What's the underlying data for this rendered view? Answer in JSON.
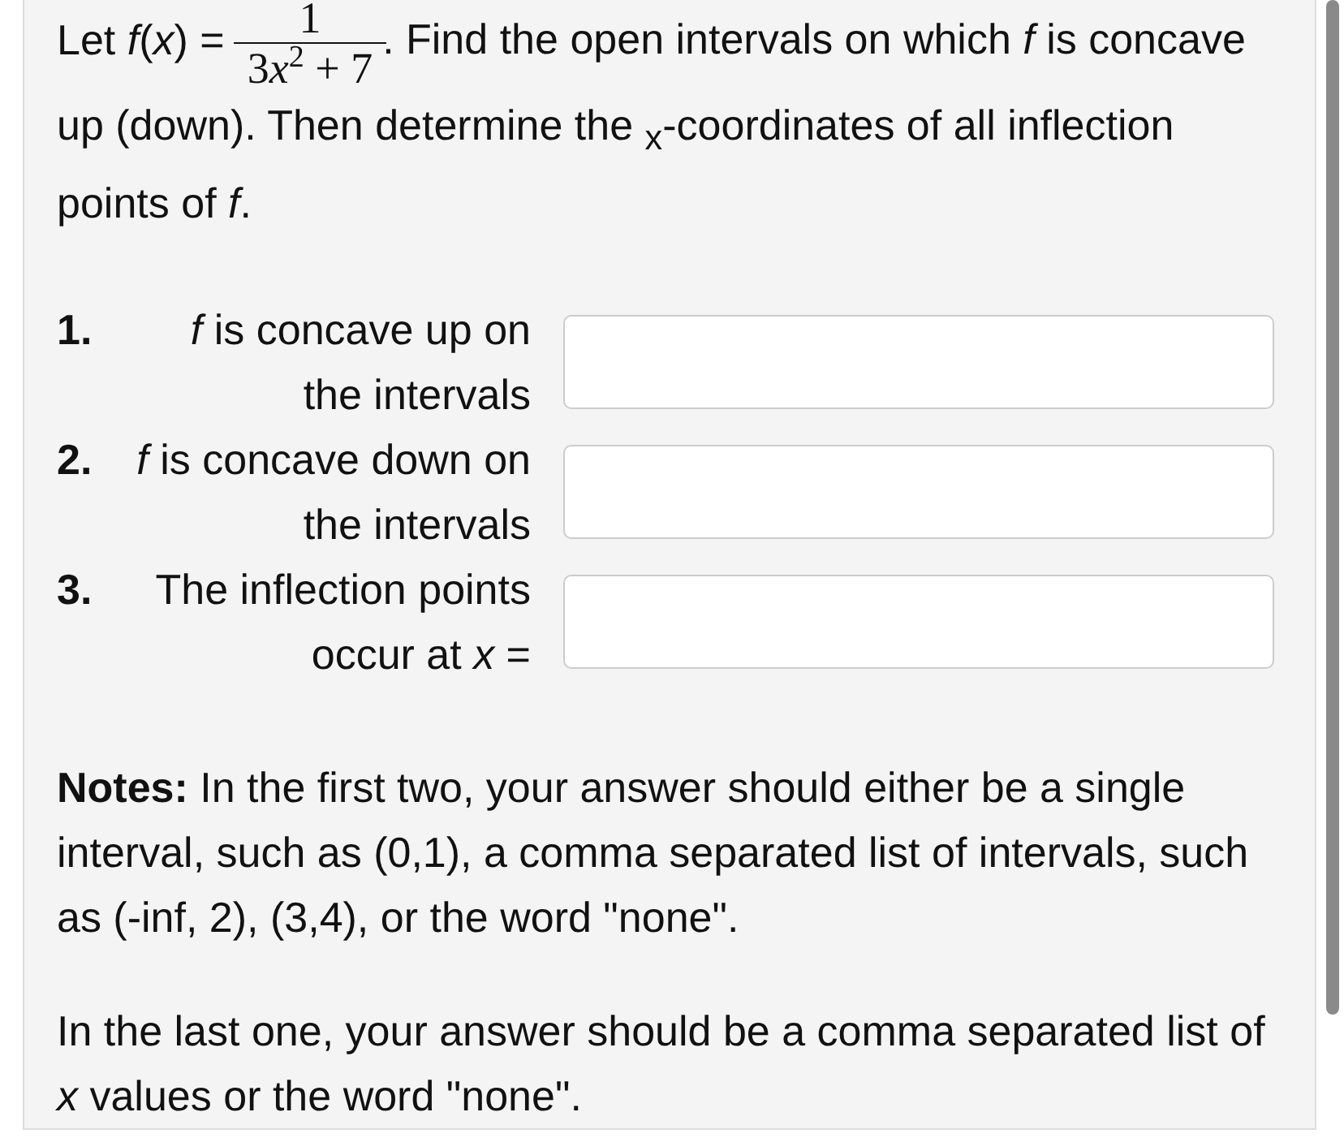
{
  "problem": {
    "lead": "Let *f*(*x*) =",
    "numerator": "1",
    "denominator": {
      "coefficient": "3",
      "variable": "x",
      "exponent": "2",
      "tail": "+ 7"
    },
    "rest": ". Find the open intervals on which *f* is concave up (down). Then determine the $_{x}$-coordinates of all inflection points of *f*."
  },
  "questions": [
    {
      "number": "1.",
      "label": "*f* is concave up on the intervals"
    },
    {
      "number": "2.",
      "label": "*f* is concave down on the intervals"
    },
    {
      "number": "3.",
      "label": "The inflection points occur at *x* ="
    }
  ],
  "notes": [
    "**Notes:** In the first two, your answer should either be a single interval, such as (0,1), a comma separated list of intervals, such as (-inf, 2), (3,4), or the word \"none\".",
    "In the last one, your answer should be a comma separated list of *x* values or the word \"none\"."
  ]
}
